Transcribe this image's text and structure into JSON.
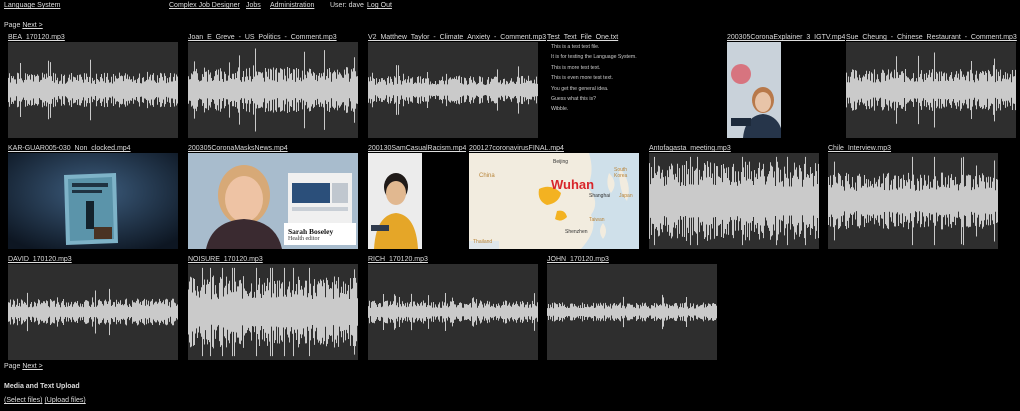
{
  "nav": {
    "home": "Language System",
    "page_label": "Page",
    "next": "Next >",
    "complex_job_designer": "Complex Job Designer",
    "jobs": "Jobs",
    "administration": "Administration",
    "user": "User: dave",
    "logout": "Log Out"
  },
  "items": [
    {
      "title": "BEA_170120.mp3",
      "kind": "audio"
    },
    {
      "title": "Joan_E_Greve_-_US_Politics_-_Comment.mp3",
      "kind": "audio"
    },
    {
      "title": "V2_Matthew_Taylor_-_Climate_Anxiety_-_Comment.mp3",
      "kind": "audio"
    },
    {
      "title": "Test_Text_File_One.txt",
      "kind": "text",
      "lines": [
        "This is a test text file.",
        "It is for testing the Language System.",
        "This is more test text.",
        "This is even more test text.",
        "You get the general idea.",
        "Guess what this is?",
        "Wibble."
      ]
    },
    {
      "title": "200305CoronaExplainer_3_IGTV.mp4",
      "kind": "video"
    },
    {
      "title": "Sue_Cheung_-_Chinese_Restaurant_-_Comment.mp3",
      "kind": "audio"
    },
    {
      "title": "KAR-GUAR005-030_Non_clocked.mp4",
      "kind": "video"
    },
    {
      "title": "200305CoronaMasksNews.mp4",
      "kind": "video",
      "caption_name": "Sarah Boseley",
      "caption_role": "Health editor"
    },
    {
      "title": "200130SamCasualRacism.mp4",
      "kind": "video"
    },
    {
      "title": "200127coronavirusFINAL.mp4",
      "kind": "video",
      "map_labels": [
        "Beijing",
        "Wuhan",
        "Shanghai",
        "South Korea",
        "Japan",
        "China",
        "Taiwan",
        "Shenzhen",
        "Thailand"
      ]
    },
    {
      "title": "Antofagasta_meeting.mp3",
      "kind": "audio"
    },
    {
      "title": "Chile_Interview.mp3",
      "kind": "audio"
    },
    {
      "title": "DAVID_170120.mp3",
      "kind": "audio"
    },
    {
      "title": "NOISURE_170120.mp3",
      "kind": "audio"
    },
    {
      "title": "RICH_170120.mp3",
      "kind": "audio"
    },
    {
      "title": "JOHN_170120.mp3",
      "kind": "audio"
    }
  ],
  "upload": {
    "heading": "Media and Text Upload",
    "select": "(Select files)",
    "upload": "(Upload files)"
  }
}
